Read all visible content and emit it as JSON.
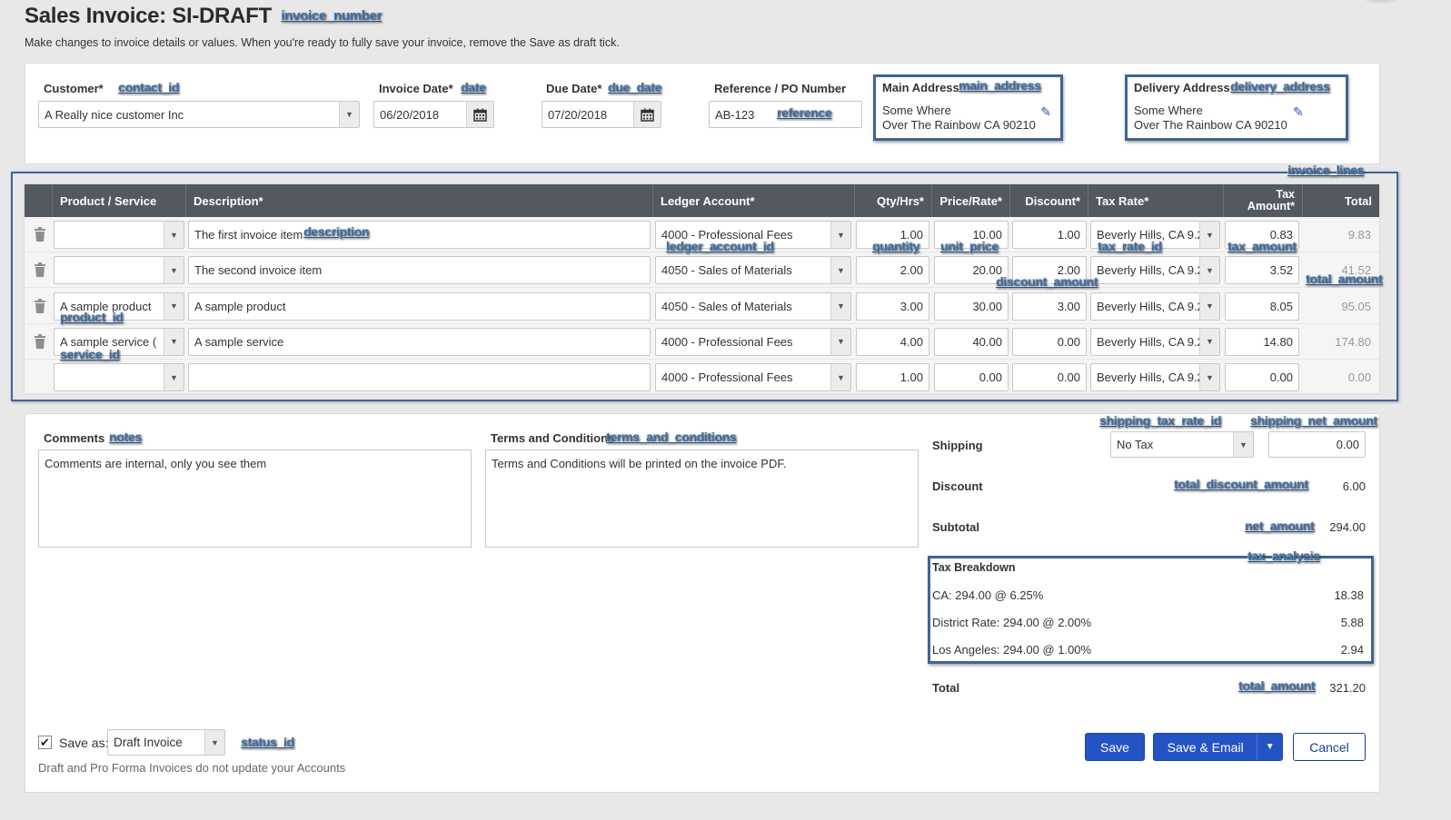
{
  "header": {
    "title": "Sales Invoice: SI-DRAFT",
    "subtitle": "Make changes to invoice details or values. When you're ready to fully save your invoice, remove the Save as draft tick."
  },
  "annotations": {
    "invoice_number": "invoice_number",
    "contact_id": "contact_id",
    "date": "date",
    "due_date": "due_date",
    "reference": "reference",
    "main_address": "main_address",
    "delivery_address": "delivery_address",
    "invoice_lines": "invoice_lines",
    "description": "description",
    "ledger_account_id": "ledger_account_id",
    "quantity": "quantity",
    "unit_price": "unit_price",
    "tax_rate_id": "tax_rate_id",
    "tax_amount": "tax_amount",
    "discount_amount": "discount_amount",
    "total_amount_line": "total_amount",
    "product_id": "product_id",
    "service_id": "service_id",
    "notes": "notes",
    "terms_and_conditions": "terms_and_conditions",
    "shipping_tax_rate_id": "shipping_tax_rate_id",
    "shipping_net_amount": "shipping_net_amount",
    "total_discount_amount": "total_discount_amount",
    "net_amount": "net_amount",
    "tax_analysis": "tax_analysis",
    "total_amount": "total_amount",
    "status_id": "status_id"
  },
  "form": {
    "customer_label": "Customer*",
    "customer_value": "A Really nice customer Inc",
    "invoice_date_label": "Invoice Date*",
    "invoice_date_value": "06/20/2018",
    "due_date_label": "Due Date*",
    "due_date_value": "07/20/2018",
    "reference_label": "Reference / PO Number",
    "reference_value": "AB-123",
    "main_address": {
      "title": "Main Address",
      "line1": "Some Where",
      "line2": "Over The Rainbow CA 90210"
    },
    "delivery_address": {
      "title": "Delivery Address",
      "line1": "Some Where",
      "line2": "Over The Rainbow CA 90210"
    }
  },
  "lines": {
    "columns": {
      "product": "Product / Service",
      "description": "Description*",
      "ledger": "Ledger Account*",
      "qty": "Qty/Hrs*",
      "price": "Price/Rate*",
      "discount": "Discount*",
      "tax_rate": "Tax Rate*",
      "tax_amount_1": "Tax",
      "tax_amount_2": "Amount*",
      "total": "Total"
    },
    "rows": [
      {
        "product": "",
        "description": "The first invoice item",
        "ledger": "4000 - Professional Fees",
        "qty": "1.00",
        "price": "10.00",
        "discount": "1.00",
        "tax_rate": "Beverly Hills, CA 9.2",
        "tax_amount": "0.83",
        "total": "9.83"
      },
      {
        "product": "",
        "description": "The second invoice item",
        "ledger": "4050 - Sales of Materials",
        "qty": "2.00",
        "price": "20.00",
        "discount": "2.00",
        "tax_rate": "Beverly Hills, CA 9.2",
        "tax_amount": "3.52",
        "total": "41.52"
      },
      {
        "product": "A sample product",
        "description": "A sample product",
        "ledger": "4050 - Sales of Materials",
        "qty": "3.00",
        "price": "30.00",
        "discount": "3.00",
        "tax_rate": "Beverly Hills, CA 9.2",
        "tax_amount": "8.05",
        "total": "95.05"
      },
      {
        "product": "A sample service (",
        "description": "A sample service",
        "ledger": "4000 - Professional Fees",
        "qty": "4.00",
        "price": "40.00",
        "discount": "0.00",
        "tax_rate": "Beverly Hills, CA 9.2",
        "tax_amount": "14.80",
        "total": "174.80"
      },
      {
        "product": "",
        "description": "",
        "ledger": "4000 - Professional Fees",
        "qty": "1.00",
        "price": "0.00",
        "discount": "0.00",
        "tax_rate": "Beverly Hills, CA 9.2",
        "tax_amount": "0.00",
        "total": "0.00"
      }
    ]
  },
  "notes": {
    "comments_label": "Comments",
    "comments_value": "Comments are internal, only you see them",
    "terms_label": "Terms and Conditions",
    "terms_value": "Terms and Conditions will be printed on the invoice PDF."
  },
  "summary": {
    "shipping_label": "Shipping",
    "shipping_tax": "No Tax",
    "shipping_amount": "0.00",
    "discount_label": "Discount",
    "discount_value": "6.00",
    "subtotal_label": "Subtotal",
    "subtotal_value": "294.00",
    "tax_breakdown_title": "Tax Breakdown",
    "tax_rows": [
      {
        "label": "CA: 294.00 @ 6.25%",
        "value": "18.38"
      },
      {
        "label": "District Rate: 294.00 @ 2.00%",
        "value": "5.88"
      },
      {
        "label": "Los Angeles: 294.00 @ 1.00%",
        "value": "2.94"
      }
    ],
    "total_label": "Total",
    "total_value": "321.20"
  },
  "footer": {
    "save_as_checked": true,
    "save_as_label": "Save as:",
    "status_value": "Draft Invoice",
    "hint": "Draft and Pro Forma Invoices do not update your Accounts",
    "save_label": "Save",
    "save_email_label": "Save & Email",
    "cancel_label": "Cancel"
  },
  "colors": {
    "primary": "#2453c4",
    "header_bg": "#535861",
    "annotation_border": "#3e6596"
  }
}
